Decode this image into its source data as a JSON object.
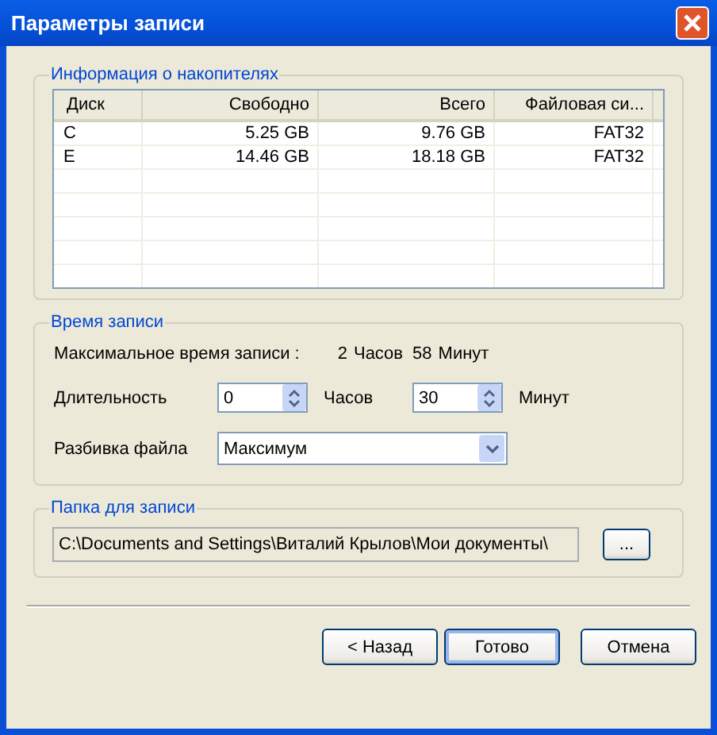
{
  "window": {
    "title": "Параметры записи"
  },
  "drives": {
    "title": "Информация о накопителях",
    "columns": [
      "Диск",
      "Свободно",
      "Всего",
      "Файловая си..."
    ],
    "rows": [
      [
        "C",
        "5.25 GB",
        "9.76 GB",
        "FAT32"
      ],
      [
        "E",
        "14.46 GB",
        "18.18 GB",
        "FAT32"
      ]
    ]
  },
  "recording_time": {
    "title": "Время записи",
    "max_label": "Максимальное время записи :",
    "max_hours": "2",
    "hours_unit": "Часов",
    "max_minutes": "58",
    "minutes_unit": "Минут",
    "duration_label": "Длительность",
    "duration_hours": "0",
    "duration_hours_unit": "Часов",
    "duration_minutes": "30",
    "duration_minutes_unit": "Минут",
    "split_label": "Разбивка файла",
    "split_value": "Максимум"
  },
  "folder": {
    "title": "Папка для записи",
    "path": "C:\\Documents and Settings\\Виталий Крылов\\Мои документы\\",
    "browse": "..."
  },
  "buttons": [
    {
      "label": "< Назад",
      "default": false
    },
    {
      "label": "Готово",
      "default": true
    },
    {
      "label": "Отмена",
      "default": false
    }
  ]
}
